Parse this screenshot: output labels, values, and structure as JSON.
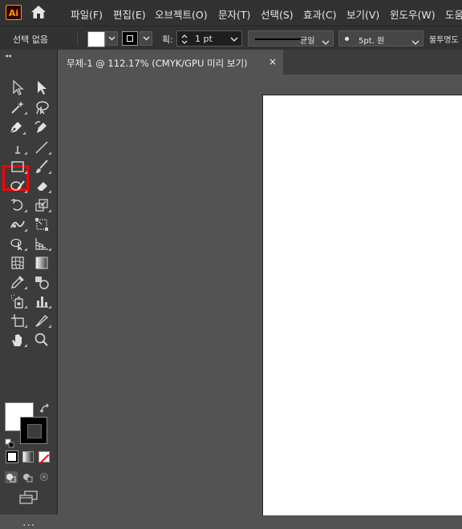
{
  "app": {
    "logo": "Ai",
    "home_icon": "home-icon"
  },
  "menu": [
    {
      "label": "파일(F)"
    },
    {
      "label": "편집(E)"
    },
    {
      "label": "오브젝트(O)"
    },
    {
      "label": "문자(T)"
    },
    {
      "label": "선택(S)"
    },
    {
      "label": "효과(C)"
    },
    {
      "label": "보기(V)"
    },
    {
      "label": "윈도우(W)"
    },
    {
      "label": "도움"
    }
  ],
  "control_bar": {
    "selection_status": "선택 없음",
    "fill_color": "#ffffff",
    "stroke_color": "#000000",
    "stroke_label": "획:",
    "stroke_weight": "1 pt",
    "profile_label": "균일",
    "brush_label": "5pt. 원",
    "opacity_label": "불투명도"
  },
  "document_tab": {
    "title": "무제-1 @ 112.17% (CMYK/GPU 미리 보기)",
    "close": "×"
  },
  "tools": {
    "selected": "pen-tool",
    "highlight_color": "#ff0000",
    "more": "..."
  },
  "colors": {
    "ui_dark": "#323232",
    "panel": "#3c3c3c",
    "canvas": "#535353",
    "artboard": "#ffffff",
    "accent": "#ff9a00"
  }
}
